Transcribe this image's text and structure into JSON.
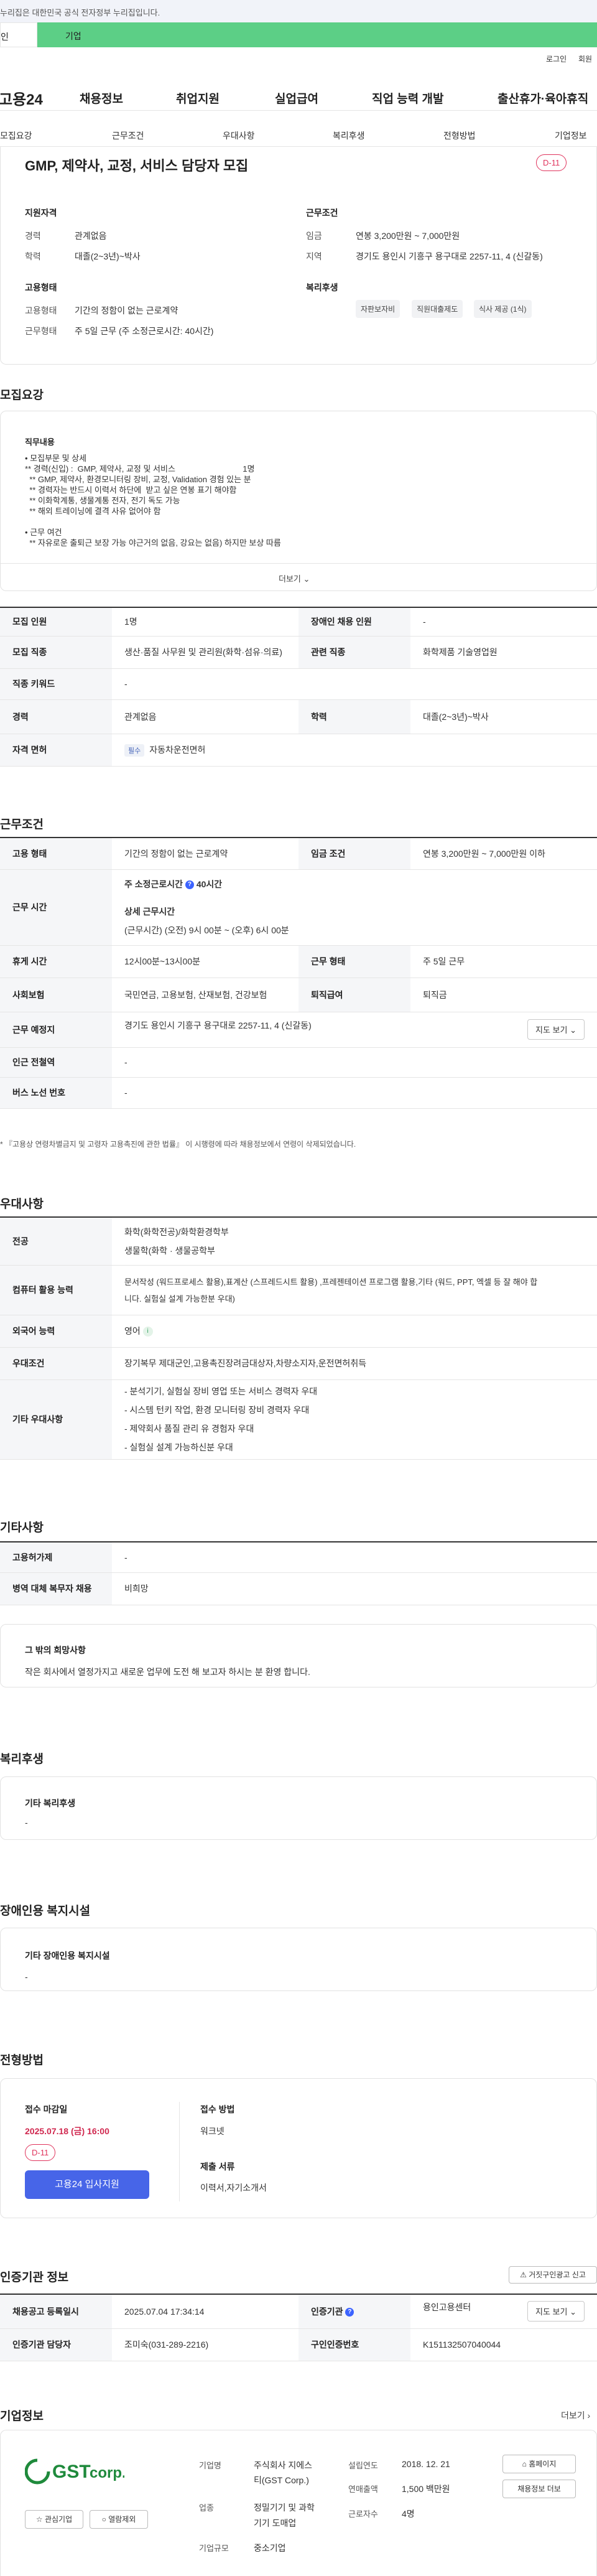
{
  "gov_notice": "정부누리집입니다. 대한민국 공식 전자정부 누리집입니다.",
  "gov_notice_visible": "누리집은 대한민국 공식 전자정부 누리집입니다.",
  "tabs": {
    "person": "인",
    "company": "기업"
  },
  "util": {
    "login": "로그인",
    "join": "회원"
  },
  "gnb": {
    "logo": "고용24",
    "items": [
      "채용정보",
      "취업지원",
      "실업급여",
      "직업 능력 개발",
      "출산휴가·육아휴직"
    ]
  },
  "subnav": [
    "모집요강",
    "근무조건",
    "우대사항",
    "복리후생",
    "전형방법",
    "기업정보"
  ],
  "job": {
    "title": "GMP, 제약사, 교정, 서비스 담당자 모집",
    "dday": "D-11",
    "qual_h": "지원자격",
    "qual": [
      {
        "k": "경력",
        "v": "관계없음"
      },
      {
        "k": "학력",
        "v": "대졸(2~3년)~박사"
      }
    ],
    "cond_h": "근무조건",
    "cond": [
      {
        "k": "임금",
        "v": "연봉 3,200만원 ~ 7,000만원"
      },
      {
        "k": "지역",
        "v": "경기도 용인시 기흥구 용구대로 2257-11, 4 (신갈동)"
      }
    ],
    "emp_h": "고용형태",
    "emp": [
      {
        "k": "고용형태",
        "v": "기간의 정함이 없는 근로계약"
      },
      {
        "k": "근무형태",
        "v": "주 5일 근무 (주 소정근로시간: 40시간)"
      }
    ],
    "welfare_h": "복리후생",
    "welfare_chips": [
      "자판보자비",
      "직원대출제도",
      "식사 제공 (1식)"
    ]
  },
  "recruit": {
    "heading": "모집요강",
    "desc_title": "직무내용",
    "desc_lines": [
      "• 모집부문 및 상세",
      "** 경력(신입) :  GMP, 제약사, 교정 및 서비스                              1명",
      "  ** GMP, 제약사, 환경모니터링 장비, 교정, Validation 경험 있는 분",
      "  ** 경력자는 반드시 이력서 하단에  받고 싶은 연봉 표기 해야함",
      "  ** 이화학계통, 생물계통 전자, 전기 독도 가능",
      "  ** 해외 트레이닝에 결격 사유 없어야 함",
      "",
      "• 근무 여건",
      "  ** 자유로운 출퇴근 보장 가능 야근거의 없음, 강요는 없음) 하지만 보상 따름"
    ],
    "more": "더보기",
    "table": [
      {
        "k1": "모집 인원",
        "v1": "1명",
        "k2": "장애인 채용 인원",
        "v2": "-"
      },
      {
        "k1": "모집 직종",
        "v1": "생산·품질 사무원 및 관리원(화학·섬유·의료)",
        "k2": "관련 직종",
        "v2": "화학제품 기술영업원"
      },
      {
        "k1": "직종 키워드",
        "v1": "-"
      },
      {
        "k1": "경력",
        "v1": "관계없음",
        "k2": "학력",
        "v2": "대졸(2~3년)~박사"
      },
      {
        "k1": "자격 면허",
        "v1_tag": "필수",
        "v1": "자동차운전면허"
      }
    ]
  },
  "work": {
    "heading": "근무조건",
    "emp_type_k": "고용 형태",
    "emp_type_v": "기간의 정함이 없는 근로계약",
    "wage_k": "임금 조건",
    "wage_v": "연봉 3,200만원 ~ 7,000만원 이하",
    "hours_k": "근무 시간",
    "hours_l1": "주 소정근로시간",
    "hours_l1b": "40시간",
    "hours_l2": "상세 근무시간",
    "hours_l3": "(근무시간) (오전) 9시 00분 ~ (오후) 6시 00분",
    "break_k": "휴게 시간",
    "break_v": "12시00분~13시00분",
    "form_k": "근무 형태",
    "form_v": "주 5일 근무",
    "ins_k": "사회보험",
    "ins_v": "국민연금, 고용보험, 산재보험, 건강보험",
    "ret_k": "퇴직급여",
    "ret_v": "퇴직금",
    "place_k": "근무 예정지",
    "place_v": "경기도 용인시 기흥구 용구대로 2257-11, 4 (신갈동)",
    "map_btn": "지도 보기",
    "subway_k": "인근 전철역",
    "subway_v": "-",
    "bus_k": "버스 노선 번호",
    "bus_v": "-",
    "note": "* 『고용상 연령차별금지 및 고령자 고용촉진에 관한 법률』 이 시행령에 따라 채용정보에서 연령이 삭제되었습니다."
  },
  "pref": {
    "heading": "우대사항",
    "major_k": "전공",
    "major_v1": "화학(화학전공)/화학환경학부",
    "major_v2": "생물학(화학 · 생물공학부",
    "pc_k": "컴퓨터 활용 능력",
    "pc_v1": "문서작성 (워드프로세스 활용),표계산 (스프레드시트 활용) ,프레젠테이션 프로그램 활용,기타 (워드, PPT, 엑셀 등 잘 해야 합",
    "pc_v2": "니다. 실험실 설계 가능한분 우대)",
    "lang_k": "외국어 능력",
    "lang_v": "영어",
    "cond_k": "우대조건",
    "cond_v": "장기복무 제대군인,고용촉진장려금대상자,차량소지자,운전면허취득",
    "etc_k": "기타 우대사항",
    "etc_v": [
      "- 분석기기, 실험실 장비 영업 또는 서비스  경력자 우대",
      "- 시스템 턴키 작업, 환경 모니터링 장비 경력자 우대",
      "- 제약회사 품질 관리 유 경험자 우대",
      "- 실험실 설계 가능하신분 우대"
    ]
  },
  "etc": {
    "heading": "기타사항",
    "k1": "고용허가제",
    "v1": "-",
    "k2": "병역 대체 복무자 채용",
    "v2": "비희망",
    "wish_h": "그 밖의 희망사항",
    "wish_v": "작은 회사에서 열정가지고 새로운 업무에 도전 해 보고자 하시는 분 환영 합니다."
  },
  "welfare": {
    "heading": "복리후생",
    "sub": "기타 복리후생",
    "v": "-"
  },
  "disab": {
    "heading": "장애인용 복지시설",
    "sub": "기타 장애인용 복지시설",
    "v": "-"
  },
  "select": {
    "heading": "전형방법",
    "deadline_k": "접수 마감일",
    "deadline_v": "2025.07.18 (금) 16:00",
    "dday": "D-11",
    "apply_btn": "고용24 입사지원",
    "method_k": "접수 방법",
    "method_v": "워크넷",
    "docs_k": "제출 서류",
    "docs_v": "이력서,자기소개서"
  },
  "cert": {
    "heading": "인증기관 정보",
    "report_btn": "거짓구인광고 신고",
    "reg_k": "채용공고 등록일시",
    "reg_v": "2025.07.04 17:34:14",
    "org_k": "인증기관",
    "org_v": "용인고용센터",
    "mgr_k": "인증기관 담당자",
    "mgr_v": "조미숙(031-289-2216)",
    "id_k": "구인인증번호",
    "id_v": "K151132507040044",
    "map_btn": "지도 보기"
  },
  "company": {
    "heading": "기업정보",
    "more": "더보기",
    "logo_text": "GST",
    "logo_sub": "corp.",
    "fav_btn": "관심기업",
    "block_btn": "열람제외",
    "name_k": "기업명",
    "name_v1": "주식회사 지에스",
    "name_v2": "티(GST Corp.)",
    "found_k": "설립연도",
    "found_v": "2018. 12. 21",
    "sales_k": "연매출액",
    "sales_v": "1,500 백만원",
    "ind_k": "업종",
    "ind_v1": "정밀기기 및 과학",
    "ind_v2": "기기 도매업",
    "emp_k": "근로자수",
    "emp_v": "4명",
    "size_k": "기업규모",
    "size_v": "중소기업",
    "home_btn": "홈페이지",
    "jobs_btn": "채용정보 더보",
    "brand_color": "#1f8a3c"
  }
}
